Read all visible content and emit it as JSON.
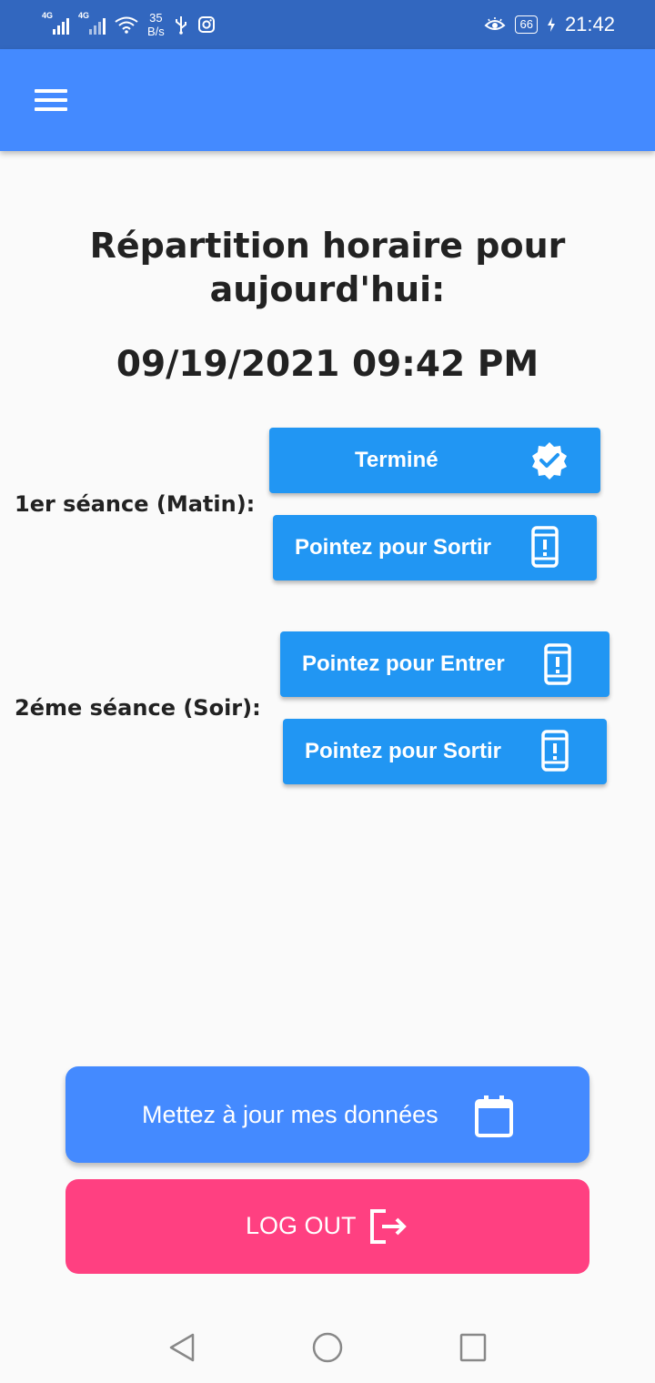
{
  "status_bar": {
    "net1": "4G",
    "net2": "4G",
    "speed_value": "35",
    "speed_unit": "B/s",
    "battery": "66",
    "time": "21:42"
  },
  "app_bar": {
    "menu_icon": "menu-icon"
  },
  "page": {
    "title": "Répartition horaire pour aujourd'hui:",
    "datetime": "09/19/2021 09:42 PM"
  },
  "sessions": [
    {
      "label": "1er séance (Matin):",
      "buttons": [
        {
          "label": "Terminé",
          "icon": "verified-badge-icon"
        },
        {
          "label": "Pointez pour Sortir",
          "icon": "phone-alert-icon"
        }
      ]
    },
    {
      "label": "2éme séance (Soir):",
      "buttons": [
        {
          "label": "Pointez pour Entrer",
          "icon": "phone-alert-icon"
        },
        {
          "label": "Pointez pour Sortir",
          "icon": "phone-alert-icon"
        }
      ]
    }
  ],
  "actions": {
    "update_label": "Mettez à jour mes données",
    "update_icon": "calendar-icon",
    "logout_label": "LOG OUT",
    "logout_icon": "logout-icon"
  },
  "colors": {
    "status_bar": "#3267bf",
    "app_bar": "#448aff",
    "button": "#2196f3",
    "logout": "#ff4081",
    "background": "#fafafa"
  }
}
